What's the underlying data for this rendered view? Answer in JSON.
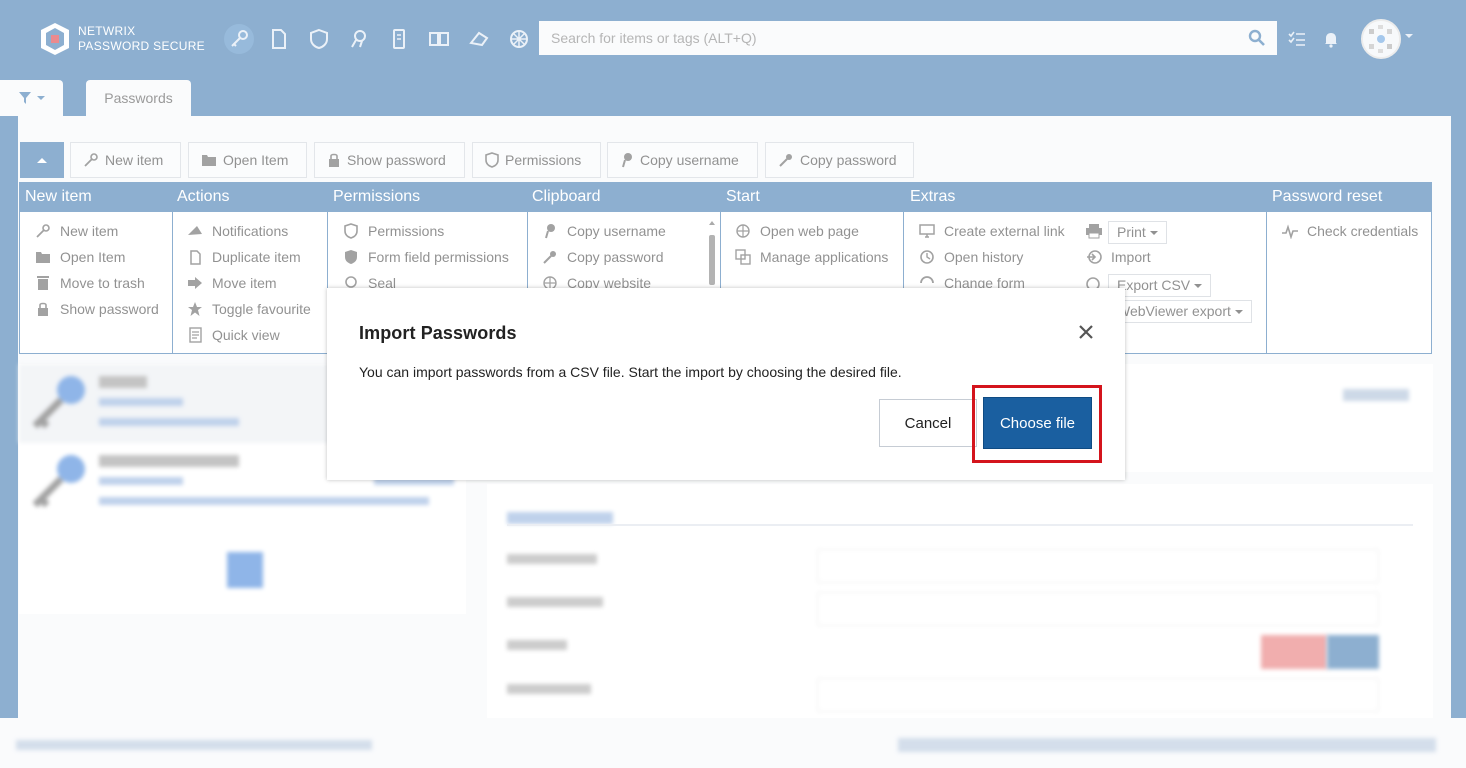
{
  "header": {
    "brand_line1": "NETWRIX",
    "brand_line2": "PASSWORD SECURE",
    "search_placeholder": "Search for items or tags (ALT+Q)",
    "nav_icons": [
      "key-icon",
      "document-icon",
      "shield-icon",
      "certificate-icon",
      "phone-icon",
      "book-icon",
      "tag-icon",
      "settings-wheel-icon"
    ]
  },
  "tabs": {
    "active": "Passwords"
  },
  "toolbar": {
    "buttons": [
      "New item",
      "Open Item",
      "Show password",
      "Permissions",
      "Copy username",
      "Copy password"
    ]
  },
  "ribbon": {
    "groups": [
      {
        "title": "New item",
        "items": [
          "New item",
          "Open Item",
          "Move to trash",
          "Show password"
        ]
      },
      {
        "title": "Actions",
        "items": [
          "Notifications",
          "Duplicate item",
          "Move item",
          "Toggle favourite",
          "Quick view"
        ]
      },
      {
        "title": "Permissions",
        "items": [
          "Permissions",
          "Form field permissions",
          "Seal"
        ]
      },
      {
        "title": "Clipboard",
        "items": [
          "Copy username",
          "Copy password",
          "Copy website"
        ]
      },
      {
        "title": "Start",
        "items": [
          "Open web page",
          "Manage applications"
        ]
      },
      {
        "title": "Extras",
        "items": [
          "Create external link",
          "Open history",
          "Change form"
        ],
        "extra_items": [
          "Print",
          "Import",
          "Export CSV",
          "WebViewer export"
        ]
      },
      {
        "title": "Password reset",
        "items": [
          "Check credentials"
        ]
      }
    ]
  },
  "modal": {
    "title": "Import Passwords",
    "message": "You can import passwords from a CSV file. Start the import by choosing the desired file.",
    "cancel_label": "Cancel",
    "choose_label": "Choose file"
  },
  "colors": {
    "brand_blue": "#1a5fa0",
    "highlight_red": "#d4141c"
  }
}
